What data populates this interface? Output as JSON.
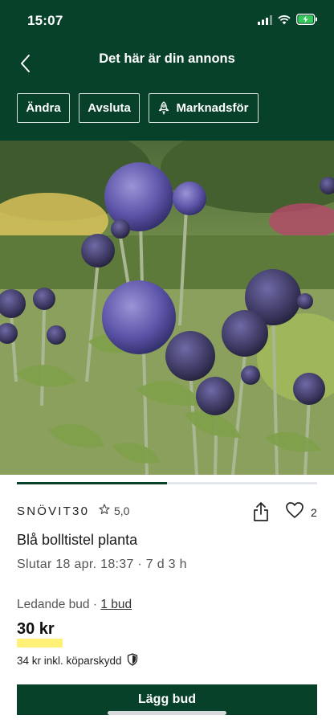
{
  "status_bar": {
    "time": "15:07",
    "battery_charging": true
  },
  "nav": {
    "title": "Det här är din annons",
    "back_icon": "chevron-left-icon"
  },
  "actions": [
    {
      "label": "Ändra"
    },
    {
      "label": "Avsluta"
    },
    {
      "label": "Marknadsför",
      "icon": "rocket-icon"
    }
  ],
  "photo": {
    "alt": "Blå bolltistel"
  },
  "image_progress": 0.5,
  "seller": {
    "name": "SNÖVIT30",
    "rating": "5,0"
  },
  "favorites": {
    "count": "2"
  },
  "item": {
    "title": "Blå bolltistel planta",
    "ends": "Slutar 18 apr. 18:37 · 7 d 3 h"
  },
  "bidding": {
    "label": "Ledande bud",
    "separator": "·",
    "bid_count": "1 bud",
    "price": "30 kr",
    "buyer_protection": "34 kr inkl. köparskydd"
  },
  "cta": {
    "label": "Lägg bud"
  },
  "colors": {
    "brand": "#07412a",
    "highlight": "#fff176"
  }
}
